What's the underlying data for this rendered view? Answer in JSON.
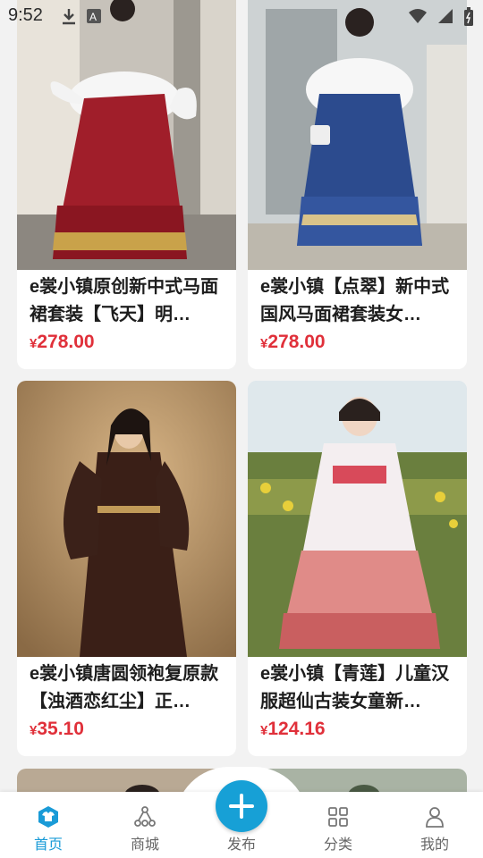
{
  "status": {
    "time": "9:52"
  },
  "products": [
    {
      "title": "e裳小镇原创新中式马面裙套装【飞天】明…",
      "price": "278.00",
      "currency": "¥",
      "image": "woman-white-blouse-red-mamian-skirt"
    },
    {
      "title": "e裳小镇【点翠】新中式国风马面裙套装女…",
      "price": "278.00",
      "currency": "¥",
      "image": "woman-white-blouse-blue-mamian-skirt"
    },
    {
      "title": "e裳小镇唐圆领袍复原款【浊酒恋红尘】正…",
      "price": "35.10",
      "currency": "¥",
      "image": "woman-dark-red-round-collar-robe"
    },
    {
      "title": "e裳小镇【青莲】儿童汉服超仙古装女童新…",
      "price": "124.16",
      "currency": "¥",
      "image": "girl-pink-hanfu-dress"
    }
  ],
  "tabs": [
    {
      "label": "首页",
      "icon": "shirt-icon",
      "active": true
    },
    {
      "label": "商城",
      "icon": "nodes-icon",
      "active": false
    },
    {
      "label": "发布",
      "icon": "plus-icon",
      "active": false
    },
    {
      "label": "分类",
      "icon": "grid-icon",
      "active": false
    },
    {
      "label": "我的",
      "icon": "user-icon",
      "active": false
    }
  ],
  "colors": {
    "accent": "#1a9bd7",
    "price": "#e0303a",
    "fab": "#17a0d6"
  }
}
